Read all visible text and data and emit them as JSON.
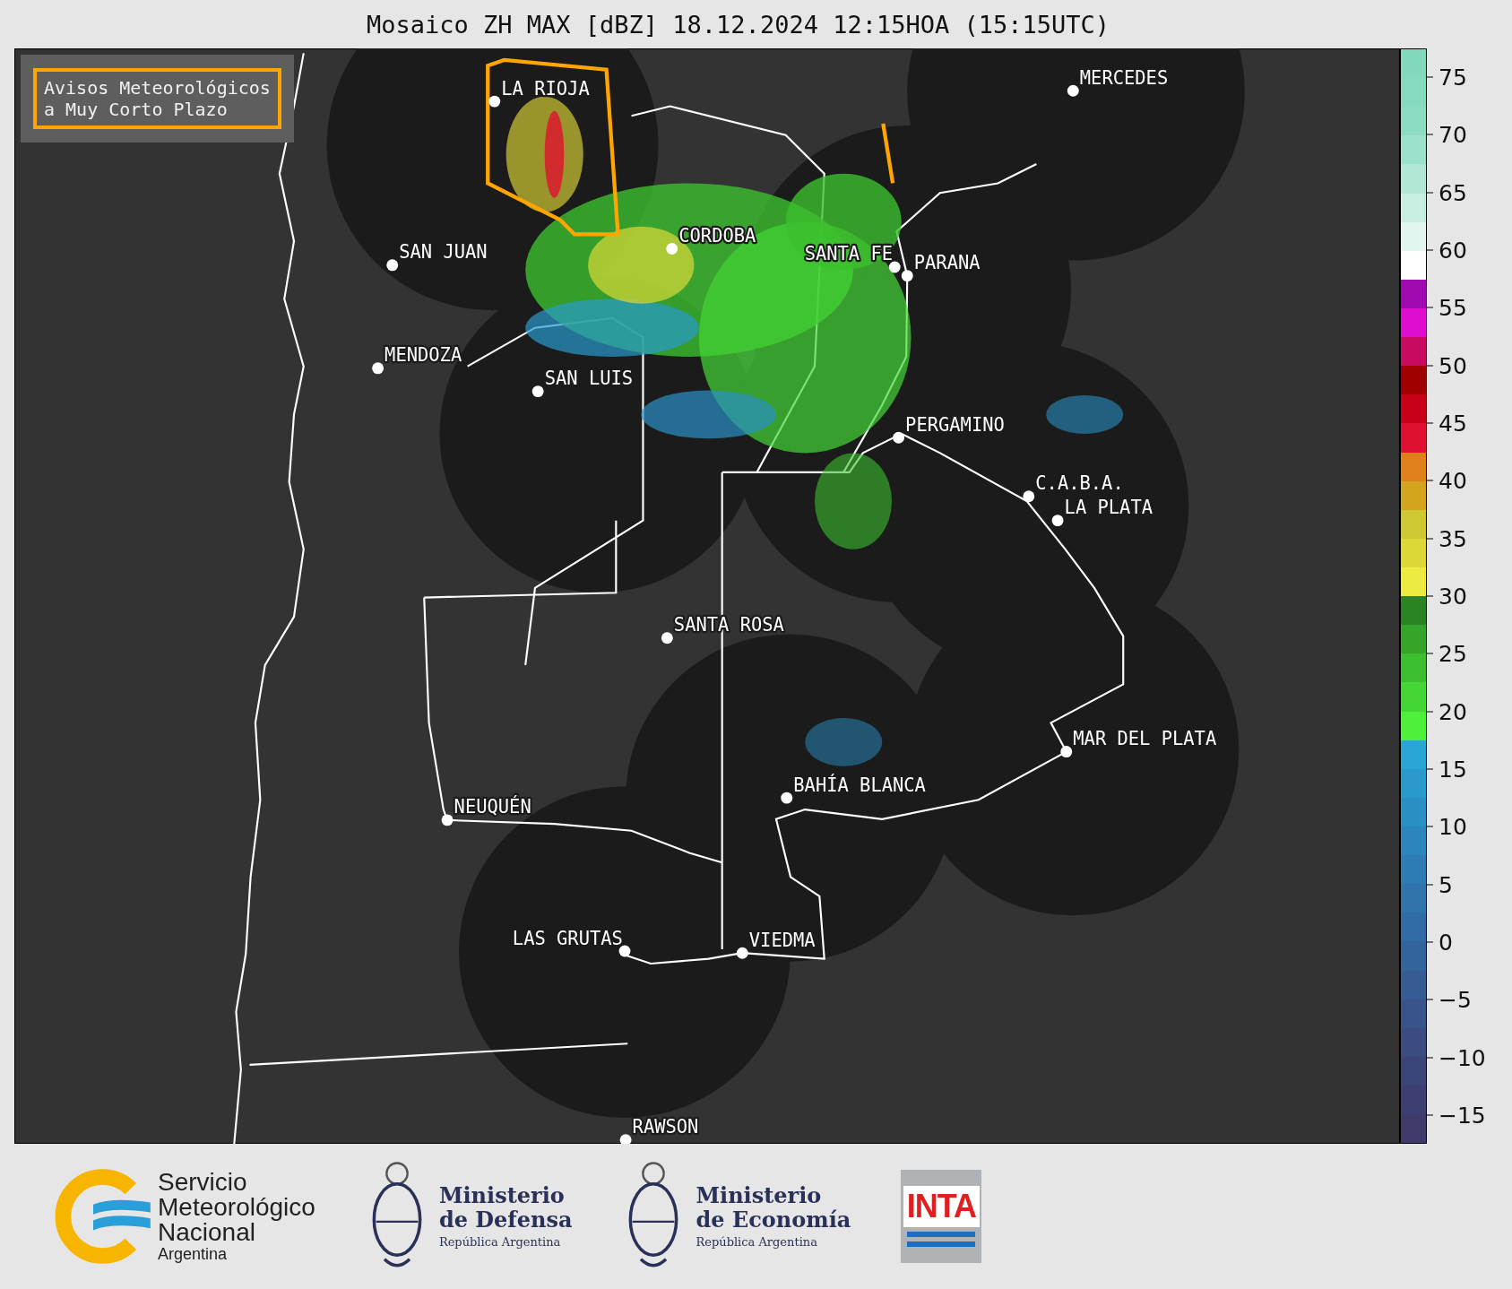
{
  "title": "Mosaico ZH MAX [dBZ] 18.12.2024 12:15HOA (15:15UTC)",
  "warning_legend": {
    "lines": [
      "Avisos Meteorológicos",
      "a Muy Corto Plazo"
    ]
  },
  "cities": [
    {
      "name": "LA RIOJA"
    },
    {
      "name": "MERCEDES"
    },
    {
      "name": "CORDOBA"
    },
    {
      "name": "SAN JUAN"
    },
    {
      "name": "SANTA FE"
    },
    {
      "name": "PARANA"
    },
    {
      "name": "MENDOZA"
    },
    {
      "name": "SAN LUIS"
    },
    {
      "name": "PERGAMINO"
    },
    {
      "name": "C.A.B.A."
    },
    {
      "name": "LA PLATA"
    },
    {
      "name": "SANTA ROSA"
    },
    {
      "name": "MAR DEL PLATA"
    },
    {
      "name": "BAHÍA BLANCA"
    },
    {
      "name": "NEUQUÉN"
    },
    {
      "name": "LAS GRUTAS"
    },
    {
      "name": "VIEDMA"
    },
    {
      "name": "RAWSON"
    }
  ],
  "colorbar": {
    "ticks": [
      "75",
      "70",
      "65",
      "60",
      "55",
      "50",
      "45",
      "40",
      "35",
      "30",
      "25",
      "20",
      "15",
      "10",
      "5",
      "0",
      "−5",
      "−10",
      "−15"
    ],
    "bins": [
      {
        "color": "#82d8bc"
      },
      {
        "color": "#86dabf"
      },
      {
        "color": "#8cdcc4"
      },
      {
        "color": "#9ce1cb"
      },
      {
        "color": "#b2e7d6"
      },
      {
        "color": "#c8eee1"
      },
      {
        "color": "#e2f6ef"
      },
      {
        "color": "#ffffff"
      },
      {
        "color": "#a00ab0"
      },
      {
        "color": "#e00cd0"
      },
      {
        "color": "#c80a60"
      },
      {
        "color": "#a00000"
      },
      {
        "color": "#c80018"
      },
      {
        "color": "#e01030"
      },
      {
        "color": "#e08018"
      },
      {
        "color": "#d4a41e"
      },
      {
        "color": "#cec832"
      },
      {
        "color": "#dcd838"
      },
      {
        "color": "#ecec40"
      },
      {
        "color": "#2a8424"
      },
      {
        "color": "#34a42a"
      },
      {
        "color": "#3cbe2e"
      },
      {
        "color": "#44d634"
      },
      {
        "color": "#4ef03c"
      },
      {
        "color": "#2aa6d6"
      },
      {
        "color": "#2a9acc"
      },
      {
        "color": "#2a90c4"
      },
      {
        "color": "#2c86bc"
      },
      {
        "color": "#2e7cb4"
      },
      {
        "color": "#3074ac"
      },
      {
        "color": "#326ca4"
      },
      {
        "color": "#34649c"
      },
      {
        "color": "#365c94"
      },
      {
        "color": "#38548a"
      },
      {
        "color": "#3a4c82"
      },
      {
        "color": "#3c4578"
      },
      {
        "color": "#3d3f72"
      },
      {
        "color": "#3e3b6a"
      }
    ]
  },
  "footer": {
    "smn": {
      "lines": [
        "Servicio",
        "Meteorológico",
        "Nacional"
      ],
      "country": "Argentina"
    },
    "ministries": [
      {
        "lines": [
          "Ministerio",
          "de Defensa"
        ],
        "country": "República Argentina"
      },
      {
        "lines": [
          "Ministerio",
          "de Economía"
        ],
        "country": "República Argentina"
      }
    ],
    "inta": "INTA"
  }
}
